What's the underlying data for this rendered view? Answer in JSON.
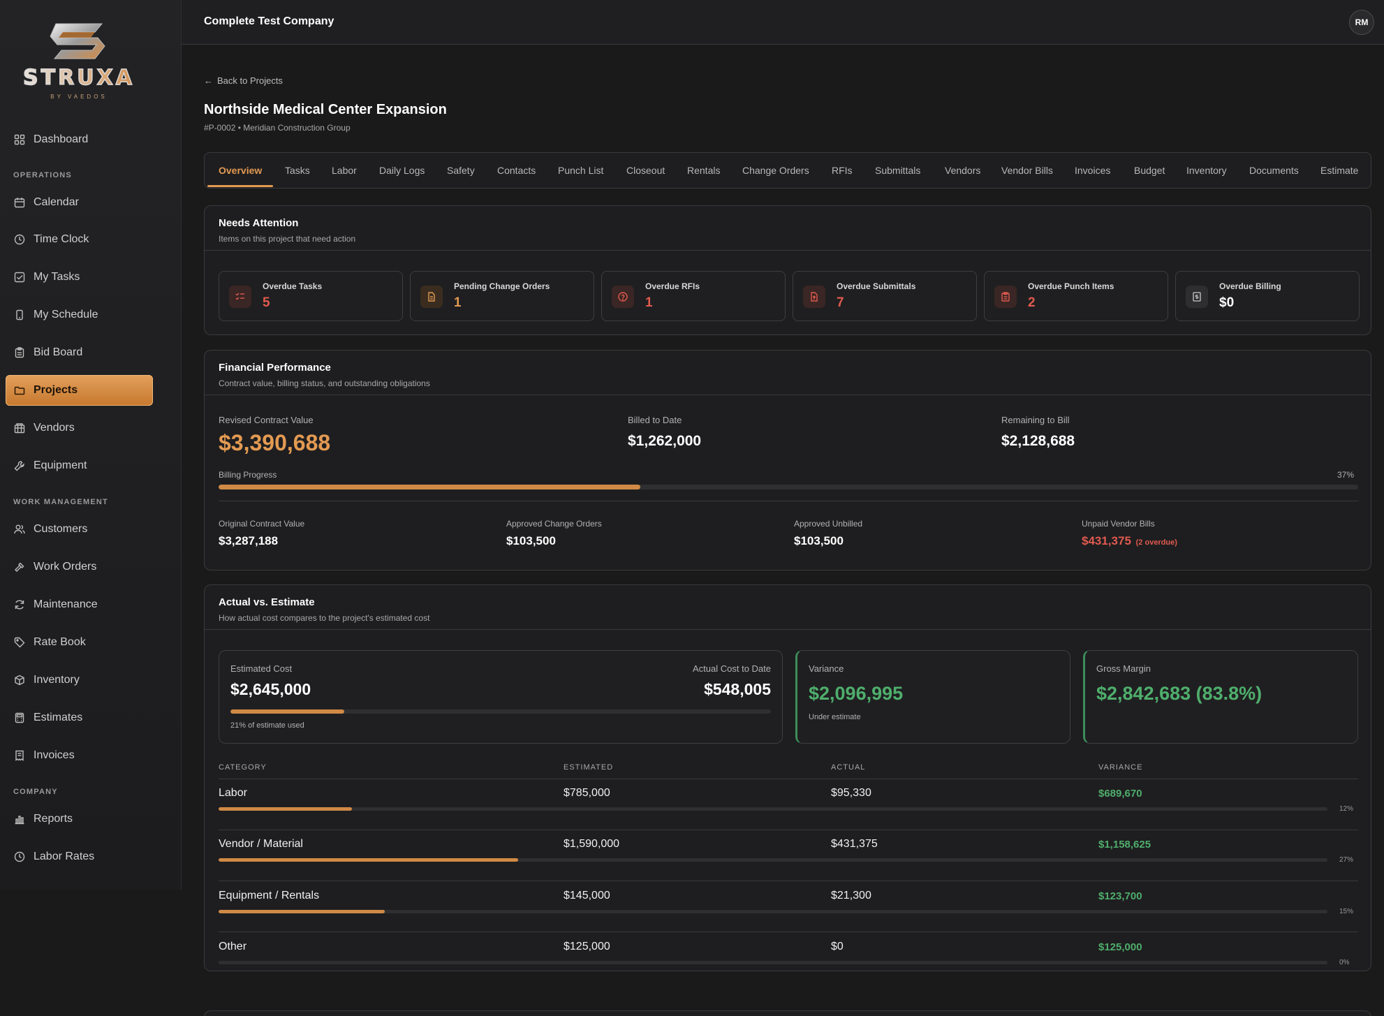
{
  "brand": {
    "name": "STRUXA",
    "tagline": "BY VAEDOS"
  },
  "header": {
    "company": "Complete Test Company",
    "avatar_initials": "RM"
  },
  "sidebar": {
    "items": [
      {
        "label": "Dashboard",
        "icon": "grid-icon"
      },
      {
        "section": "OPERATIONS"
      },
      {
        "label": "Calendar",
        "icon": "calendar-icon"
      },
      {
        "label": "Time Clock",
        "icon": "clock-icon"
      },
      {
        "label": "My Tasks",
        "icon": "checkbox-icon"
      },
      {
        "label": "My Schedule",
        "icon": "phone-icon"
      },
      {
        "label": "Bid Board",
        "icon": "clipboard-icon"
      },
      {
        "label": "Projects",
        "icon": "folder-icon",
        "active": true
      },
      {
        "label": "Vendors",
        "icon": "building-icon"
      },
      {
        "label": "Equipment",
        "icon": "wrench-icon"
      },
      {
        "section": "WORK MANAGEMENT"
      },
      {
        "label": "Customers",
        "icon": "users-icon"
      },
      {
        "label": "Work Orders",
        "icon": "hammer-icon"
      },
      {
        "label": "Maintenance",
        "icon": "refresh-icon"
      },
      {
        "label": "Rate Book",
        "icon": "tag-icon"
      },
      {
        "label": "Inventory",
        "icon": "box-icon"
      },
      {
        "label": "Estimates",
        "icon": "calculator-icon"
      },
      {
        "label": "Invoices",
        "icon": "receipt-icon"
      },
      {
        "section": "COMPANY"
      },
      {
        "label": "Reports",
        "icon": "bar-chart-icon"
      },
      {
        "label": "Labor Rates",
        "icon": "dollar-clock-icon"
      }
    ]
  },
  "project": {
    "back_label": "Back to Projects",
    "title": "Northside Medical Center Expansion",
    "subtitle": "#P-0002 • Meridian Construction Group"
  },
  "tabs": [
    "Overview",
    "Tasks",
    "Labor",
    "Daily Logs",
    "Safety",
    "Contacts",
    "Punch List",
    "Closeout",
    "Rentals",
    "Change Orders",
    "RFIs",
    "Submittals",
    "Vendors",
    "Vendor Bills",
    "Invoices",
    "Budget",
    "Inventory",
    "Documents",
    "Estimate"
  ],
  "needs_attention": {
    "title": "Needs Attention",
    "desc": "Items on this project that need action",
    "items": [
      {
        "label": "Overdue Tasks",
        "value": "5",
        "color": "#e05a4f",
        "icon": "list-check-icon"
      },
      {
        "label": "Pending Change Orders",
        "value": "1",
        "color": "#e39a52",
        "icon": "document-icon"
      },
      {
        "label": "Overdue RFIs",
        "value": "1",
        "color": "#e05a4f",
        "icon": "question-icon"
      },
      {
        "label": "Overdue Submittals",
        "value": "7",
        "color": "#e05a4f",
        "icon": "file-upload-icon"
      },
      {
        "label": "Overdue Punch Items",
        "value": "2",
        "color": "#e05a4f",
        "icon": "clipboard-list-icon"
      },
      {
        "label": "Overdue Billing",
        "value": "$0",
        "color": "#ffffff",
        "icon": "receipt-dollar-icon"
      }
    ]
  },
  "financial": {
    "title": "Financial Performance",
    "desc": "Contract value, billing status, and outstanding obligations",
    "revised_label": "Revised Contract Value",
    "revised_value": "$3,390,688",
    "billed_label": "Billed to Date",
    "billed_value": "$1,262,000",
    "remaining_label": "Remaining to Bill",
    "remaining_value": "$2,128,688",
    "progress_label": "Billing Progress",
    "progress_pct_text": "37%",
    "progress_fraction": 0.37,
    "original_label": "Original Contract Value",
    "original_value": "$3,287,188",
    "approved_co_label": "Approved Change Orders",
    "approved_co_value": "$103,500",
    "approved_unbilled_label": "Approved Unbilled",
    "approved_unbilled_value": "$103,500",
    "unpaid_label": "Unpaid Vendor Bills",
    "unpaid_value": "$431,375",
    "unpaid_note": "(2 overdue)"
  },
  "actual_vs_estimate": {
    "title": "Actual vs. Estimate",
    "desc": "How actual cost compares to the project's estimated cost",
    "estimated_label": "Estimated Cost",
    "estimated_value": "$2,645,000",
    "actual_label": "Actual Cost to Date",
    "actual_value": "$548,005",
    "used_text": "21% of estimate used",
    "used_fraction": 0.21,
    "variance_label": "Variance",
    "variance_value": "$2,096,995",
    "variance_note": "Under estimate",
    "margin_label": "Gross Margin",
    "margin_value": "$2,842,683 (83.8%)",
    "columns": [
      "CATEGORY",
      "ESTIMATED",
      "ACTUAL",
      "VARIANCE"
    ],
    "rows": [
      {
        "category": "Labor",
        "estimated": "$785,000",
        "actual": "$95,330",
        "variance": "$689,670",
        "pct_text": "12%",
        "fraction": 0.12
      },
      {
        "category": "Vendor / Material",
        "estimated": "$1,590,000",
        "actual": "$431,375",
        "variance": "$1,158,625",
        "pct_text": "27%",
        "fraction": 0.27
      },
      {
        "category": "Equipment / Rentals",
        "estimated": "$145,000",
        "actual": "$21,300",
        "variance": "$123,700",
        "pct_text": "15%",
        "fraction": 0.15
      },
      {
        "category": "Other",
        "estimated": "$125,000",
        "actual": "$0",
        "variance": "$125,000",
        "pct_text": "0%",
        "fraction": 0
      }
    ]
  },
  "colors": {
    "accent": "#e39a52",
    "danger": "#e05a4f",
    "success": "#4fae6c"
  }
}
